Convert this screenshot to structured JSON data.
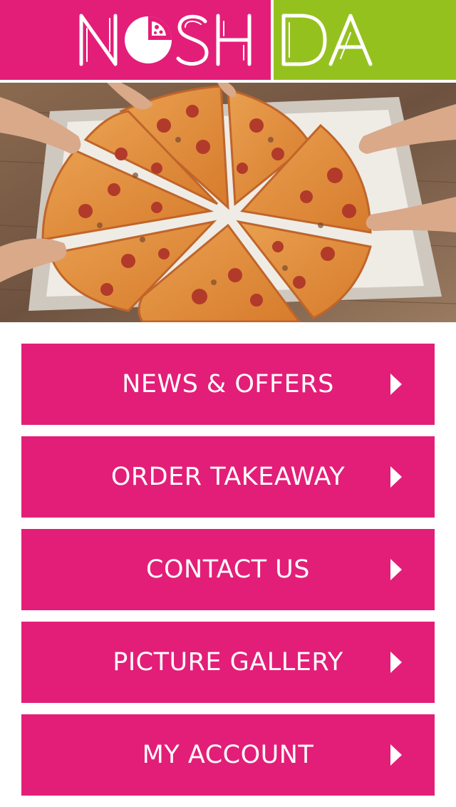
{
  "logo": {
    "left_text": "NOSH",
    "right_text": "DA",
    "left_color": "#e31e78",
    "right_color": "#95c11f"
  },
  "hero": {
    "image": "pizza-slices-being-shared-photo"
  },
  "menu": {
    "accent_color": "#e31e78",
    "items": [
      {
        "label": "NEWS & OFFERS",
        "icon": "chevron-right-icon"
      },
      {
        "label": "ORDER TAKEAWAY",
        "icon": "chevron-right-icon"
      },
      {
        "label": "CONTACT US",
        "icon": "chevron-right-icon"
      },
      {
        "label": "PICTURE GALLERY",
        "icon": "chevron-right-icon"
      },
      {
        "label": "MY ACCOUNT",
        "icon": "chevron-right-icon"
      }
    ]
  }
}
